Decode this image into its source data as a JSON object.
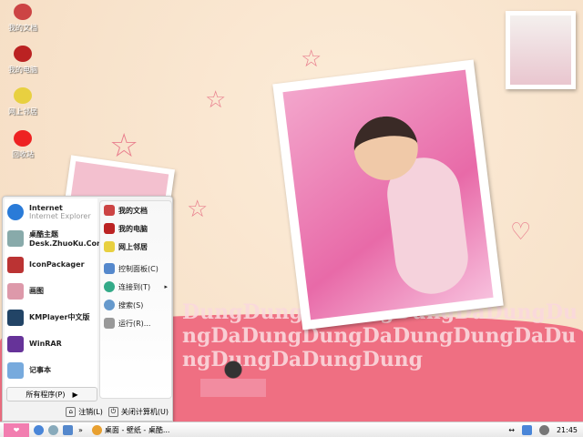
{
  "desktop": {
    "icons": [
      {
        "label": "我的文档",
        "color": "#c44"
      },
      {
        "label": "我的电脑",
        "color": "#b22"
      },
      {
        "label": "网上邻居",
        "color": "#e8d040"
      },
      {
        "label": "回收站",
        "color": "#e22"
      }
    ],
    "background_letters": "DungDungDaDungDungDaDungDungDaDungDungDaDungDungDaDungDungDaDungDung"
  },
  "start_menu": {
    "pinned": [
      {
        "title": "Internet",
        "subtitle": "Internet Explorer",
        "color": "#2a7bd8"
      },
      {
        "title": "桌酷主题",
        "subtitle": "Desk.ZhuoKu.Com",
        "color": "#8aa"
      },
      {
        "title": "IconPackager",
        "color": "#b33"
      },
      {
        "title": "画图",
        "color": "#d9a"
      },
      {
        "title": "KMPlayer中文版",
        "color": "#246"
      },
      {
        "title": "WinRAR",
        "color": "#639"
      },
      {
        "title": "记事本",
        "color": "#7ad"
      }
    ],
    "right": [
      {
        "label": "我的文档",
        "bold": true,
        "color": "#c44"
      },
      {
        "label": "我的电脑",
        "bold": true,
        "color": "#b22"
      },
      {
        "label": "网上邻居",
        "bold": true,
        "color": "#e8d040"
      },
      {
        "label": "控制面板(C)",
        "color": "#58c"
      },
      {
        "label": "连接到(T)",
        "color": "#3a8",
        "arrow": "▸"
      },
      {
        "label": "搜索(S)",
        "color": "#69c"
      },
      {
        "label": "运行(R)...",
        "color": "#999"
      }
    ],
    "all_programs": "所有程序(P)",
    "all_programs_arrow": "▶",
    "logoff": "注销(L)",
    "shutdown": "关闭计算机(U)"
  },
  "taskbar": {
    "start": "❤",
    "chevron": "»",
    "task": "桌面 - 壁纸 - 桌酷...",
    "tray_arrow": "↔",
    "clock": "21:45"
  }
}
